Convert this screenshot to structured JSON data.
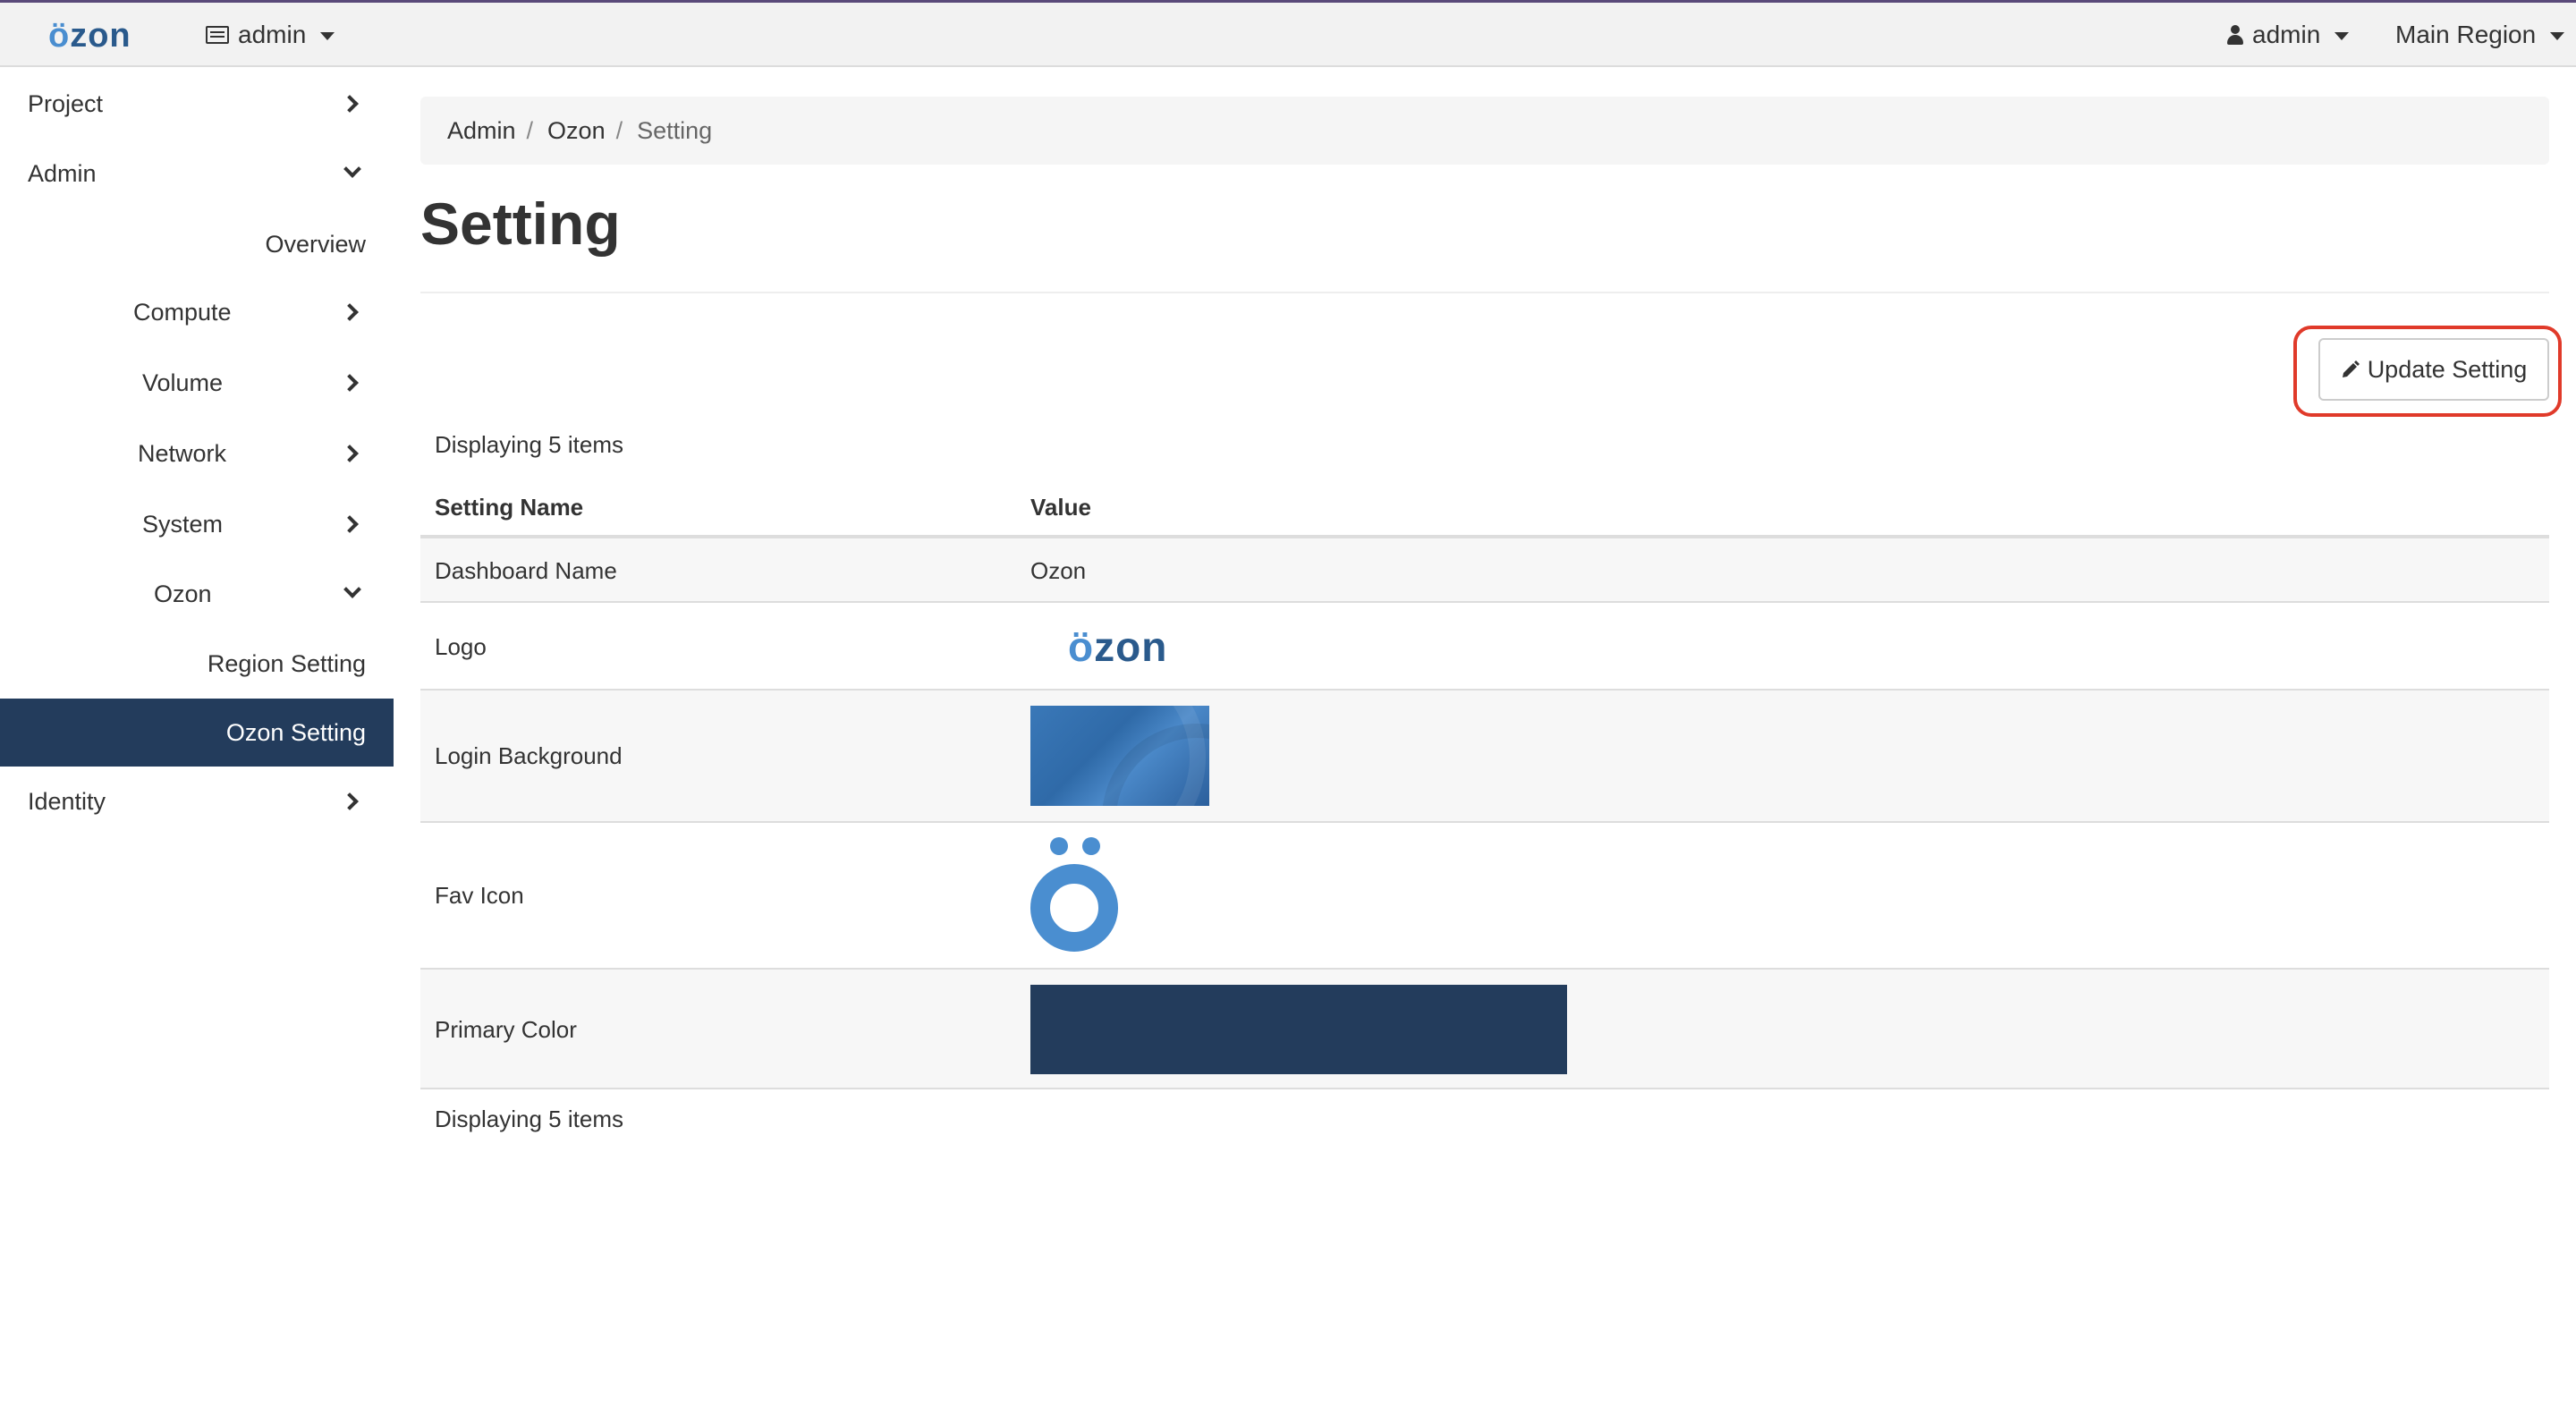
{
  "navbar": {
    "brand": "ozon",
    "project_label": "admin",
    "user_label": "admin",
    "region_label": "Main Region"
  },
  "sidebar": {
    "items": [
      {
        "label": "Project",
        "chevron": "right"
      },
      {
        "label": "Admin",
        "chevron": "down"
      },
      {
        "label": "Overview",
        "chevron": ""
      },
      {
        "label": "Compute",
        "chevron": "right"
      },
      {
        "label": "Volume",
        "chevron": "right"
      },
      {
        "label": "Network",
        "chevron": "right"
      },
      {
        "label": "System",
        "chevron": "right"
      },
      {
        "label": "Ozon",
        "chevron": "down"
      },
      {
        "label": "Region Setting",
        "chevron": ""
      },
      {
        "label": "Ozon Setting",
        "chevron": "",
        "active": true
      },
      {
        "label": "Identity",
        "chevron": "right"
      }
    ]
  },
  "breadcrumb": {
    "items": [
      "Admin",
      "Ozon"
    ],
    "current": "Setting"
  },
  "page": {
    "title": "Setting",
    "update_button": "Update Setting",
    "count_top": "Displaying 5 items",
    "count_bottom": "Displaying 5 items"
  },
  "table": {
    "headers": [
      "Setting Name",
      "Value"
    ],
    "rows": [
      {
        "name": "Dashboard Name",
        "value": "Ozon",
        "kind": "text"
      },
      {
        "name": "Logo",
        "value": "ozon",
        "kind": "logo"
      },
      {
        "name": "Login Background",
        "value": "",
        "kind": "image"
      },
      {
        "name": "Fav Icon",
        "value": "",
        "kind": "favicon"
      },
      {
        "name": "Primary Color",
        "value": "",
        "kind": "color"
      }
    ]
  },
  "colors": {
    "primary": "#233c5c",
    "brand_dark": "#2a5a8c",
    "brand_light": "#4a8ed0",
    "highlight": "#e03a2a"
  }
}
